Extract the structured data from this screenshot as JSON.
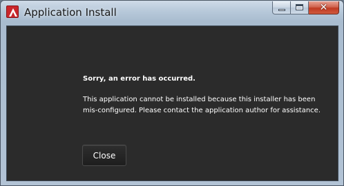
{
  "window": {
    "title": "Application Install"
  },
  "controls": {
    "minimize": "minimize-icon",
    "maximize": "maximize-icon",
    "close": "close-icon"
  },
  "dialog": {
    "heading": "Sorry, an error has occurred.",
    "message": "This application cannot be installed because this installer has been mis-configured. Please contact the application author for assistance.",
    "close_label": "Close"
  },
  "colors": {
    "content_background": "#2b2b2b",
    "close_control": "#c03a22",
    "app_icon": "#c9262b"
  }
}
